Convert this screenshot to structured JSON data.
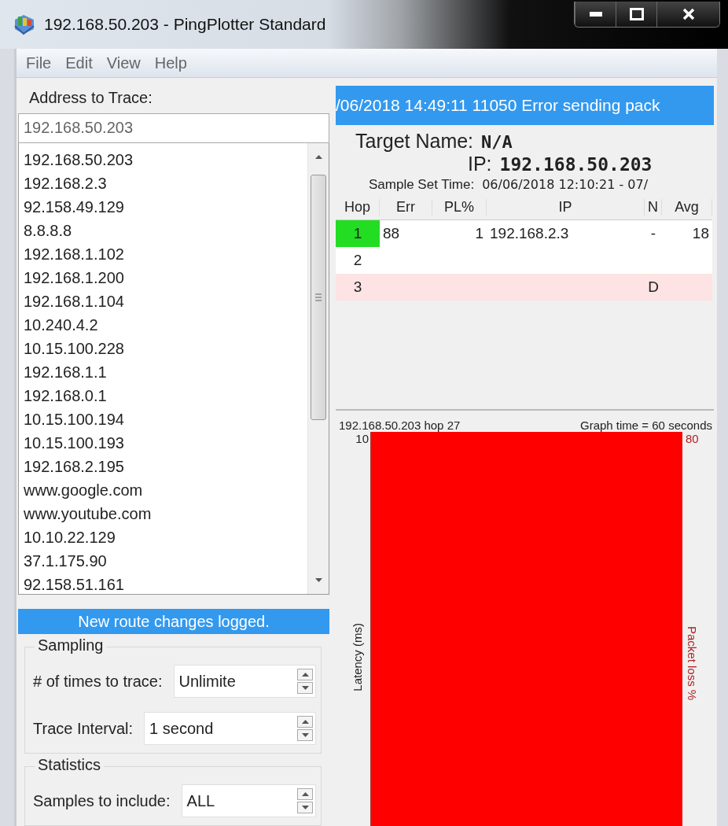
{
  "window": {
    "title": "192.168.50.203 - PingPlotter Standard"
  },
  "menu": [
    "File",
    "Edit",
    "View",
    "Help"
  ],
  "address": {
    "label": "Address to Trace:",
    "value": "192.168.50.203"
  },
  "history": [
    "192.168.50.203",
    "192.168.2.3",
    "92.158.49.129",
    "8.8.8.8",
    "192.168.1.102",
    "192.168.1.200",
    "192.168.1.104",
    "10.240.4.2",
    "10.15.100.228",
    "192.168.1.1",
    "192.168.0.1",
    "10.15.100.194",
    "10.15.100.193",
    "192.168.2.195",
    "www.google.com",
    "www.youtube.com",
    "10.10.22.129",
    "37.1.175.90",
    "92.158.51.161"
  ],
  "route_notice": "New route changes logged.",
  "sampling": {
    "title": "Sampling",
    "fields": [
      {
        "label": "# of times to trace:",
        "value": "Unlimite"
      },
      {
        "label": "Trace Interval:",
        "value": "1 second"
      }
    ]
  },
  "statistics": {
    "title": "Statistics",
    "fields": [
      {
        "label": "Samples to include:",
        "value": "ALL"
      }
    ]
  },
  "error_banner": "/06/2018 14:49:11 11050 Error sending pack",
  "target": {
    "name_label": "Target Name:",
    "name": "N/A",
    "ip_label": "IP:",
    "ip": "192.168.50.203",
    "time_label": "Sample Set Time:",
    "time": "06/06/2018 12:10:21 - 07/"
  },
  "table": {
    "columns": [
      "Hop",
      "Err",
      "PL%",
      "IP",
      "N",
      "Avg"
    ],
    "rows": [
      {
        "kind": "ok",
        "cells": [
          "1",
          "88",
          "1",
          "192.168.2.3",
          "-",
          "18"
        ]
      },
      {
        "kind": "empty",
        "cells": [
          "2",
          "",
          "",
          "",
          "",
          ""
        ]
      },
      {
        "kind": "failed",
        "cells": [
          "3",
          "",
          "",
          "",
          "D",
          ""
        ]
      }
    ]
  },
  "graph": {
    "title": "192.168.50.203 hop 27",
    "time": "Graph time = 60 seconds",
    "left_tick": "10",
    "right_tick": "80",
    "ylabel": "Latency (ms)",
    "y2label": "Packet loss %"
  }
}
